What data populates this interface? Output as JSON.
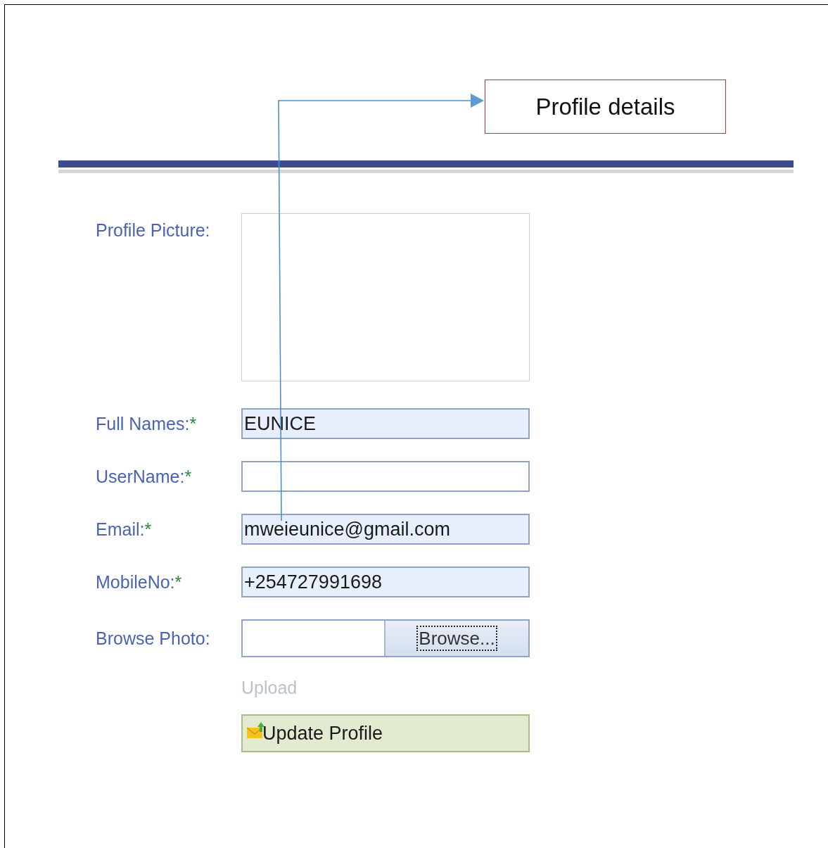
{
  "annotation": {
    "label": "Profile details"
  },
  "form": {
    "picture_label": "Profile Picture:",
    "fields": [
      {
        "label": "Full Names:",
        "required_mark": "*",
        "value": "EUNICE"
      },
      {
        "label": "UserName:",
        "required_mark": "*"
      },
      {
        "label": "Email:",
        "required_mark": "*",
        "value": "mweieunice@gmail.com"
      },
      {
        "label": "MobileNo:",
        "required_mark": "*",
        "value": "+254727991698"
      }
    ],
    "browse": {
      "label": "Browse Photo:",
      "button": "Browse...",
      "focused": true
    },
    "upload": {
      "label": "Upload",
      "disabled": true
    },
    "submit": {
      "label": "Update Profile"
    }
  }
}
